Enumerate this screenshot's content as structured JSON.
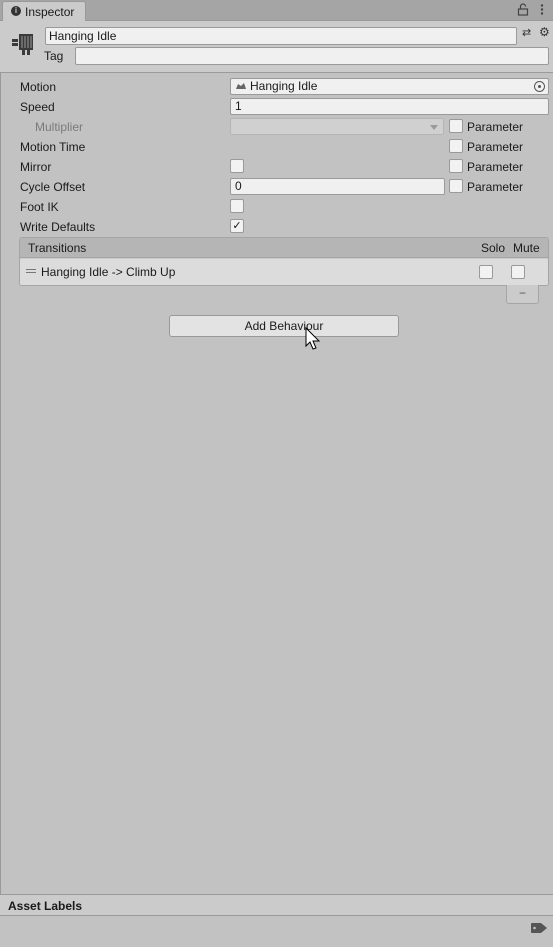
{
  "window": {
    "tab_title": "Inspector",
    "tab_icon": "info-icon"
  },
  "header": {
    "name_value": "Hanging Idle",
    "tag_label": "Tag",
    "tag_value": "",
    "asset_icon": "animator-state-icon"
  },
  "properties": {
    "motion_label": "Motion",
    "motion_value": "Hanging Idle",
    "speed_label": "Speed",
    "speed_value": "1",
    "multiplier_label": "Multiplier",
    "multiplier_value": "",
    "motion_time_label": "Motion Time",
    "mirror_label": "Mirror",
    "mirror_checked": false,
    "cycle_offset_label": "Cycle Offset",
    "cycle_offset_value": "0",
    "foot_ik_label": "Foot IK",
    "foot_ik_checked": false,
    "write_defaults_label": "Write Defaults",
    "write_defaults_checked": true,
    "parameter_label": "Parameter"
  },
  "transitions": {
    "header": "Transitions",
    "solo_label": "Solo",
    "mute_label": "Mute",
    "items": [
      {
        "label": "Hanging Idle -> Climb Up",
        "solo": false,
        "mute": false
      }
    ],
    "remove_label": "−"
  },
  "add_behaviour_label": "Add Behaviour",
  "asset_labels": {
    "title": "Asset Labels"
  },
  "colors": {
    "background": "#c2c2c2",
    "panel": "#cbcbcb",
    "field": "#f0f0f0"
  }
}
